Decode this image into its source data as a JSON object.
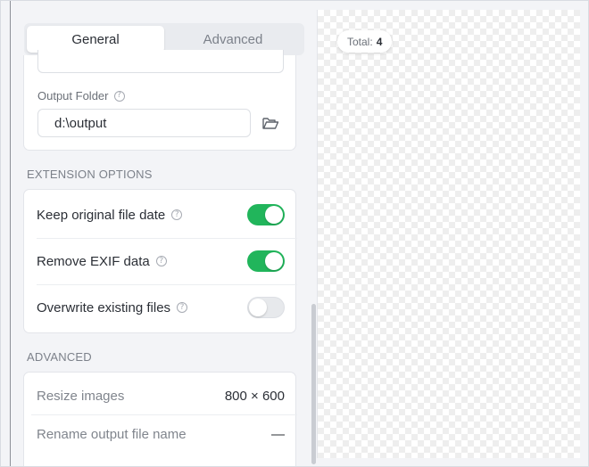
{
  "tabs": [
    {
      "label": "General",
      "active": true
    },
    {
      "label": "Advanced",
      "active": false
    }
  ],
  "output": {
    "label": "Output Folder",
    "value": "d:\\output"
  },
  "extension": {
    "header": "EXTENSION OPTIONS",
    "options": [
      {
        "label": "Keep original file date",
        "enabled": true
      },
      {
        "label": "Remove EXIF data",
        "enabled": true
      },
      {
        "label": "Overwrite existing files",
        "enabled": false
      }
    ]
  },
  "advanced": {
    "header": "ADVANCED",
    "rows": [
      {
        "label": "Resize images",
        "value": "800 × 600"
      },
      {
        "label": "Rename output file name",
        "value": "—"
      }
    ]
  },
  "preview": {
    "total_label": "Total:",
    "total_value": "4"
  },
  "colors": {
    "toggle_on": "#21b55b",
    "toggle_off": "#e7e9ec"
  },
  "icons": {
    "help": "question-circle-icon",
    "folder": "folder-open-icon"
  }
}
